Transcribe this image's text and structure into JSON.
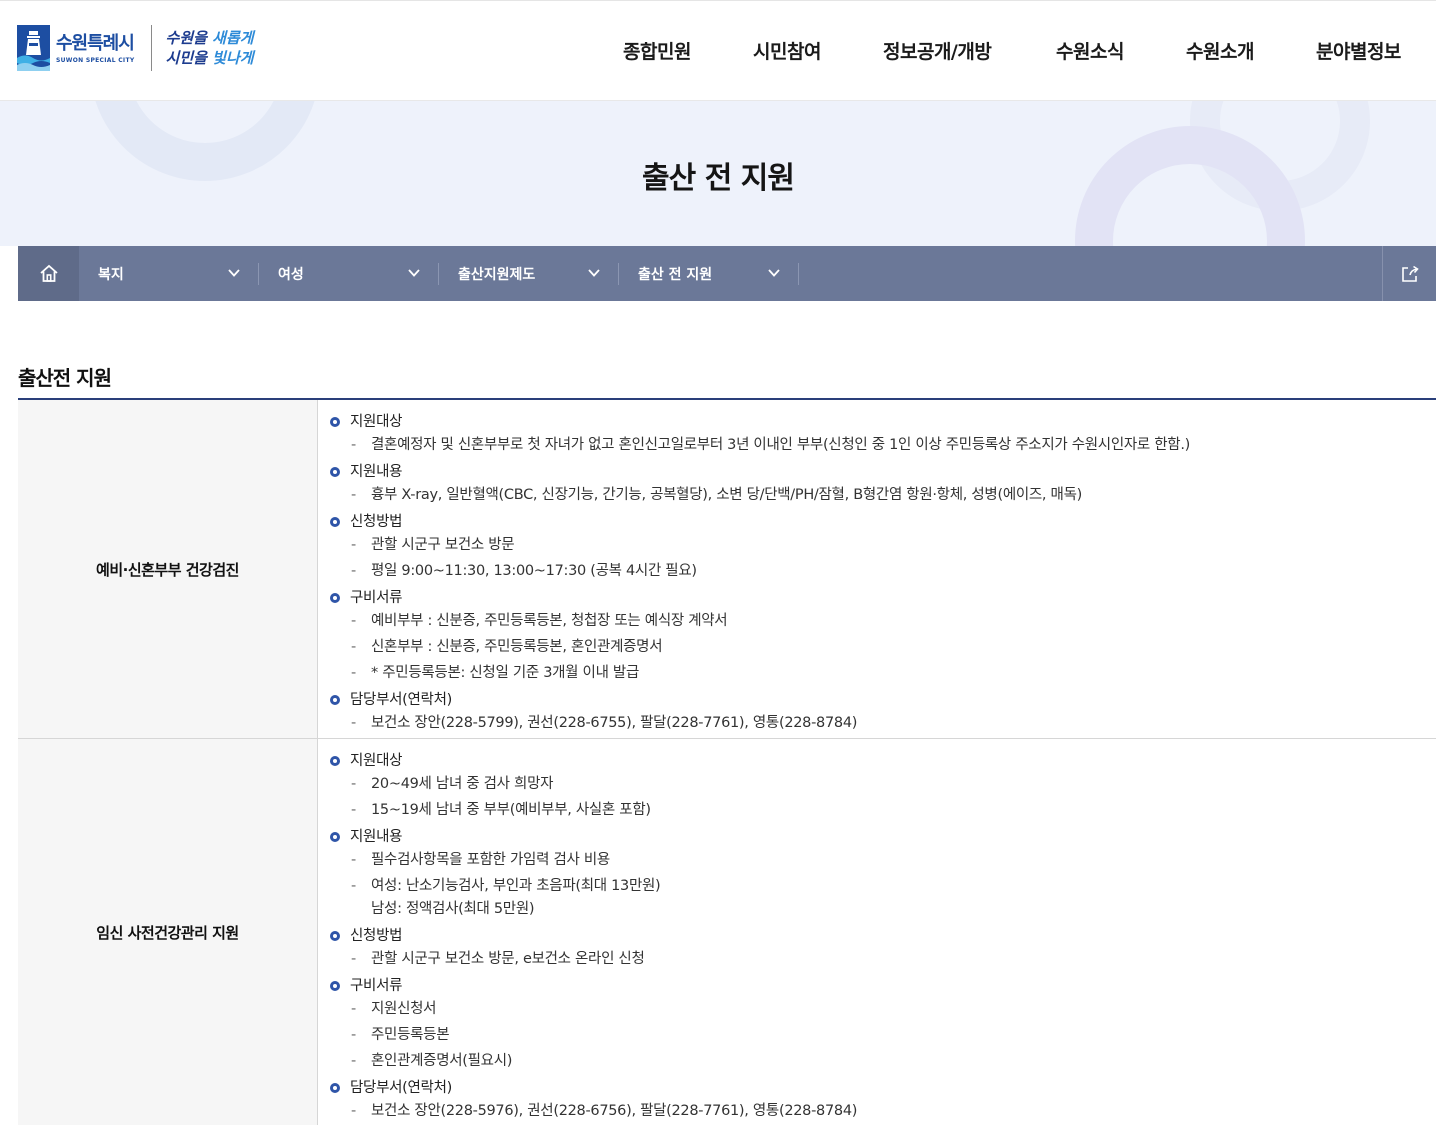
{
  "header": {
    "logo_ko": "수원특례시",
    "logo_en": "SUWON SPECIAL CITY",
    "slogan_line1_a": "수원을 ",
    "slogan_line1_b": "새롭게",
    "slogan_line2_a": "시민을 ",
    "slogan_line2_b": "빛나게",
    "nav": [
      "종합민원",
      "시민참여",
      "정보공개/개방",
      "수원소식",
      "수원소개",
      "분야별정보"
    ]
  },
  "banner": {
    "title": "출산 전 지원"
  },
  "location": {
    "items": [
      "복지",
      "여성",
      "출산지원제도",
      "출산 전 지원"
    ]
  },
  "section_title": "출산전 지원",
  "rows": [
    {
      "title": "예비·신혼부부 건강검진",
      "blocks": [
        {
          "heading": "지원대상",
          "items": [
            "결혼예정자 및 신혼부부로 첫 자녀가 없고 혼인신고일로부터 3년 이내인 부부(신청인 중 1인 이상 주민등록상 주소지가 수원시인자로 한함.)"
          ]
        },
        {
          "heading": "지원내용",
          "items": [
            "흉부 X-ray, 일반혈액(CBC, 신장기능, 간기능, 공복혈당), 소변 당/단백/PH/잠혈, B형간염 항원·항체, 성병(에이즈, 매독)"
          ]
        },
        {
          "heading": "신청방법",
          "items": [
            "관할 시군구 보건소 방문",
            "평일 9:00~11:30, 13:00~17:30 (공복 4시간 필요)"
          ]
        },
        {
          "heading": "구비서류",
          "items": [
            "예비부부 : 신분증, 주민등록등본, 청첩장 또는 예식장 계약서",
            "신혼부부 : 신분증, 주민등록등본, 혼인관계증명서",
            "* 주민등록등본: 신청일 기준 3개월 이내 발급"
          ]
        },
        {
          "heading": "담당부서(연락처)",
          "items": [
            "보건소 장안(228-5799), 권선(228-6755), 팔달(228-7761), 영통(228-8784)"
          ]
        }
      ]
    },
    {
      "title": "임신 사전건강관리 지원",
      "blocks": [
        {
          "heading": "지원대상",
          "items": [
            "20~49세 남녀 중 검사 희망자",
            "15~19세 남녀 중 부부(예비부부, 사실혼 포함)"
          ]
        },
        {
          "heading": "지원내용",
          "items": [
            "필수검사항목을 포함한 가임력 검사 비용",
            "여성: 난소기능검사, 부인과 초음파(최대 13만원)|남성: 정액검사(최대 5만원)"
          ]
        },
        {
          "heading": "신청방법",
          "items": [
            "관할 시군구 보건소 방문, e보건소 온라인 신청"
          ]
        },
        {
          "heading": "구비서류",
          "items": [
            "지원신청서",
            "주민등록등본",
            "혼인관계증명서(필요시)"
          ]
        },
        {
          "heading": "담당부서(연락처)",
          "items": [
            "보건소 장안(228-5976), 권선(228-6756), 팔달(228-7761), 영통(228-8784)"
          ]
        }
      ]
    }
  ],
  "colors": {
    "brand": "#1d4ea2",
    "locbar": "#6b7898",
    "bullet": "#2f55a8",
    "banner_bg": "#eef2fb"
  },
  "icons": [
    "home-icon",
    "chevron-down-icon",
    "share-icon",
    "lighthouse-logo-icon"
  ]
}
